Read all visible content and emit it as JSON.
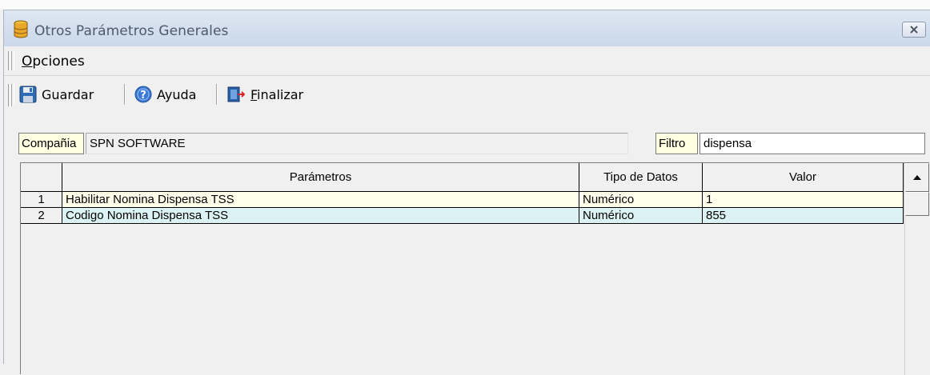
{
  "window": {
    "title": "Otros Parámetros Generales",
    "icon": "database-icon"
  },
  "menu": {
    "opciones_mnemonic": "O",
    "opciones_rest": "pciones"
  },
  "toolbar": {
    "guardar_label": "Guardar",
    "ayuda_label": "Ayuda",
    "finalizar_mnemonic": "F",
    "finalizar_rest": "inalizar"
  },
  "filters": {
    "compania_label": "Compañia",
    "compania_value": "SPN SOFTWARE",
    "filtro_label": "Filtro",
    "filtro_value": "dispensa"
  },
  "grid": {
    "columns": [
      "",
      "Parámetros",
      "Tipo de Datos",
      "Valor"
    ],
    "rows": [
      {
        "n": "1",
        "parametro": "Habilitar Nomina Dispensa TSS",
        "tipo": "Numérico",
        "valor": "1"
      },
      {
        "n": "2",
        "parametro": "Codigo Nomina Dispensa TSS",
        "tipo": "Numérico",
        "valor": "855"
      }
    ]
  },
  "colors": {
    "row1_bg": "#ffffec",
    "row2_bg": "#dcf3f5",
    "label_bg": "#ffffe1",
    "titlebar_bg": "#d3dfee"
  }
}
